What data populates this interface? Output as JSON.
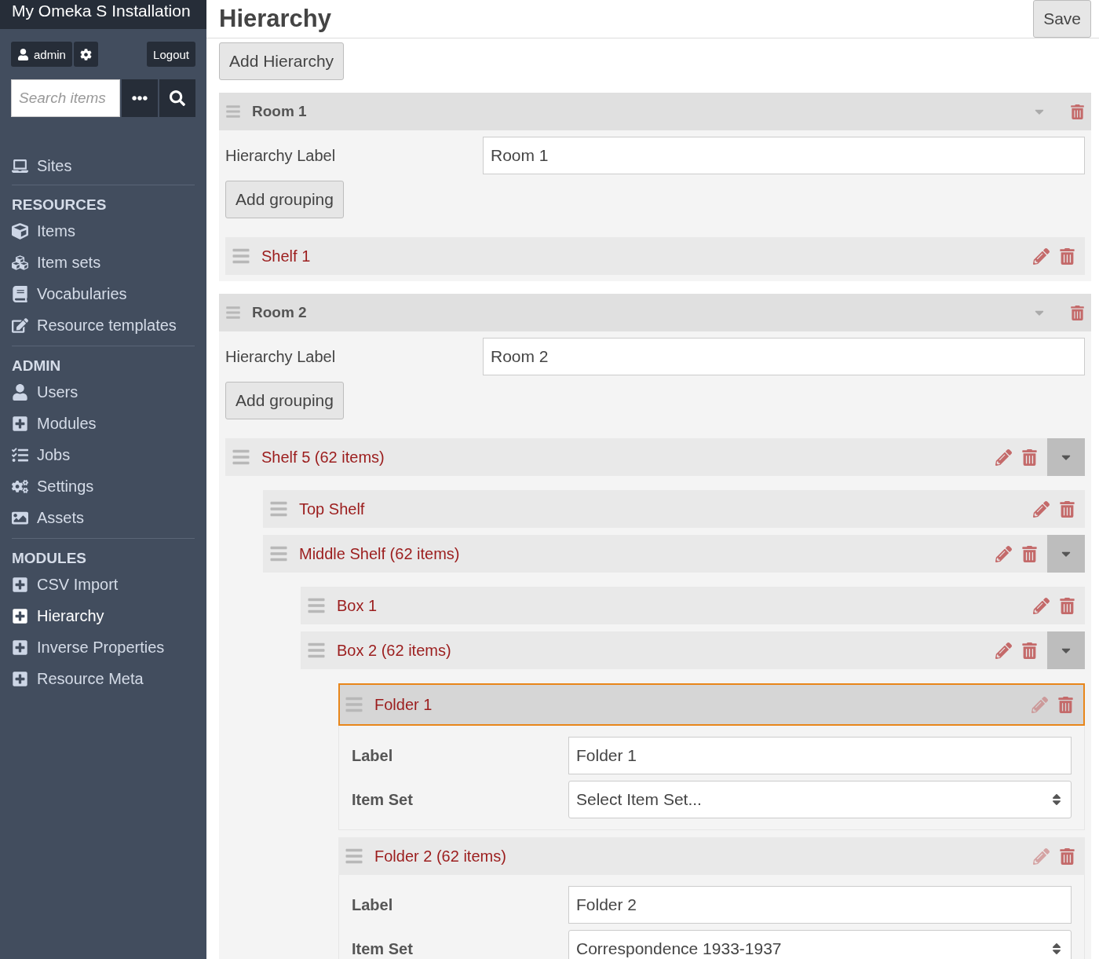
{
  "sidebar": {
    "title": "My Omeka S Installation",
    "user": "admin",
    "logout": "Logout",
    "search": {
      "placeholder": "Search items"
    },
    "sections": [
      {
        "items": [
          {
            "label": "Sites",
            "selected": false
          }
        ]
      },
      {
        "heading": "RESOURCES",
        "items": [
          {
            "label": "Items",
            "selected": false
          },
          {
            "label": "Item sets",
            "selected": false
          },
          {
            "label": "Vocabularies",
            "selected": false
          },
          {
            "label": "Resource templates",
            "selected": false
          }
        ]
      },
      {
        "heading": "ADMIN",
        "items": [
          {
            "label": "Users",
            "selected": false
          },
          {
            "label": "Modules",
            "selected": false
          },
          {
            "label": "Jobs",
            "selected": false
          },
          {
            "label": "Settings",
            "selected": false
          },
          {
            "label": "Assets",
            "selected": false
          }
        ]
      },
      {
        "heading": "MODULES",
        "items": [
          {
            "label": "CSV Import",
            "selected": false
          },
          {
            "label": "Hierarchy",
            "selected": true
          },
          {
            "label": "Inverse Properties",
            "selected": false
          },
          {
            "label": "Resource Meta",
            "selected": false
          }
        ]
      }
    ]
  },
  "page": {
    "title": "Hierarchy",
    "save": "Save",
    "add_hierarchy": "Add Hierarchy"
  },
  "hierarchies": [
    {
      "name": "Room 1",
      "label_caption": "Hierarchy Label",
      "label_value": "Room 1",
      "add_grouping": "Add grouping",
      "groupings": [
        {
          "label": "Shelf 1",
          "focused": false,
          "editing": false
        }
      ]
    },
    {
      "name": "Room 2",
      "label_caption": "Hierarchy Label",
      "label_value": "Room 2",
      "add_grouping": "Add grouping",
      "groupings": [
        {
          "label": "Shelf 5 (62 items)",
          "expanded": true,
          "focused": false,
          "editing": false,
          "children": [
            {
              "label": "Top Shelf",
              "focused": false,
              "editing": false
            },
            {
              "label": "Middle Shelf (62 items)",
              "expanded": true,
              "focused": false,
              "editing": false,
              "children": [
                {
                  "label": "Box 1",
                  "focused": false,
                  "editing": false
                },
                {
                  "label": "Box 2 (62 items)",
                  "expanded": true,
                  "focused": false,
                  "editing": false,
                  "children": [
                    {
                      "label": "Folder 1",
                      "focused": true,
                      "editing": true,
                      "form": {
                        "label_caption": "Label",
                        "label_value": "Folder 1",
                        "item_set_caption": "Item Set",
                        "item_set_value": "Select Item Set..."
                      }
                    },
                    {
                      "label": "Folder 2 (62 items)",
                      "focused": false,
                      "editing": true,
                      "form": {
                        "label_caption": "Label",
                        "label_value": "Folder 2",
                        "item_set_caption": "Item Set",
                        "item_set_value": "Correspondence 1933-1937"
                      }
                    }
                  ]
                }
              ]
            }
          ]
        }
      ]
    }
  ]
}
